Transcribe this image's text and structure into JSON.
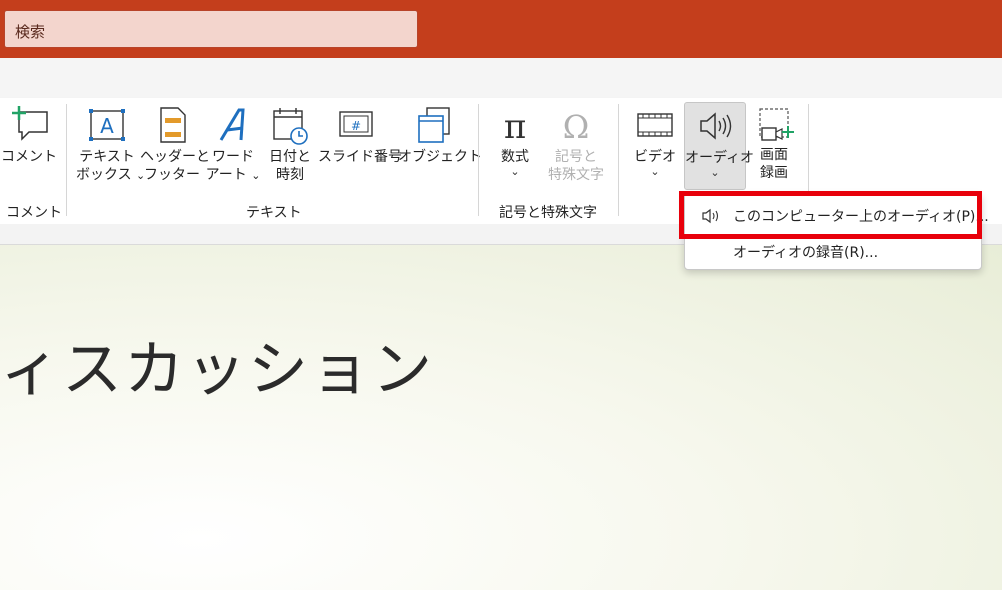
{
  "search": {
    "label": "検索"
  },
  "ribbon": {
    "comment": {
      "label": "コメント",
      "group": "コメント"
    },
    "text_group": {
      "label": "テキスト",
      "textbox": [
        "テキスト",
        "ボックス"
      ],
      "header_footer": [
        "ヘッダーと",
        "フッター"
      ],
      "wordart": [
        "ワード",
        "アート"
      ],
      "datetime": [
        "日付と",
        "時刻"
      ],
      "slide_number": "スライド番号",
      "object": "オブジェクト"
    },
    "symbols_group": {
      "label": "記号と特殊文字",
      "equation": "数式",
      "symbol": [
        "記号と",
        "特殊文字"
      ]
    },
    "media": {
      "video": "ビデオ",
      "audio": "オーディオ",
      "screen_recording": [
        "画面",
        "録画"
      ]
    },
    "chevron": "⌄"
  },
  "slide": {
    "title": "ィスカッション"
  },
  "dropdown": {
    "items": [
      {
        "label": "このコンピューター上のオーディオ(P)..."
      },
      {
        "label": "オーディオの録音(R)..."
      }
    ]
  },
  "colors": {
    "accent": "#c43e1c",
    "highlight": "#e8000b",
    "icon_blue": "#1e6fbf"
  }
}
